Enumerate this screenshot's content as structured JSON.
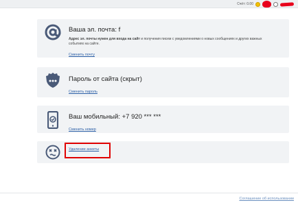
{
  "topbar": {
    "balance_label": "Счёт: 0.00",
    "icons": [
      "coin-icon",
      "avatar-icon",
      "smiley-icon",
      "username-redacted"
    ]
  },
  "email": {
    "title": "Ваша эл. почта: f",
    "desc_bold": "Адрес эл. почты нужен для входа на сайт",
    "desc_rest": " и получения писем с уведомлениями о новых сообщениях и других важных событиях на сайте.",
    "link": "Сменить почту",
    "icon": "at-sign-icon"
  },
  "password": {
    "title": "Пароль от сайта (скрыт)",
    "link": "Сменить пароль",
    "icon": "shield-icon"
  },
  "phone": {
    "title": "Ваш мобильный: +7 920 *** ***",
    "link": "Сменить номер",
    "icon": "phone-icon"
  },
  "profile": {
    "link": "Удаление анкеты",
    "icon": "dizzy-face-icon"
  },
  "footer": {
    "terms": "Соглашение об использовании"
  },
  "colors": {
    "card_bg": "#f1f3f5",
    "icon": "#4a5a78",
    "link": "#2b5fa7",
    "highlight": "#e00000",
    "accent_red": "#e8001c"
  }
}
